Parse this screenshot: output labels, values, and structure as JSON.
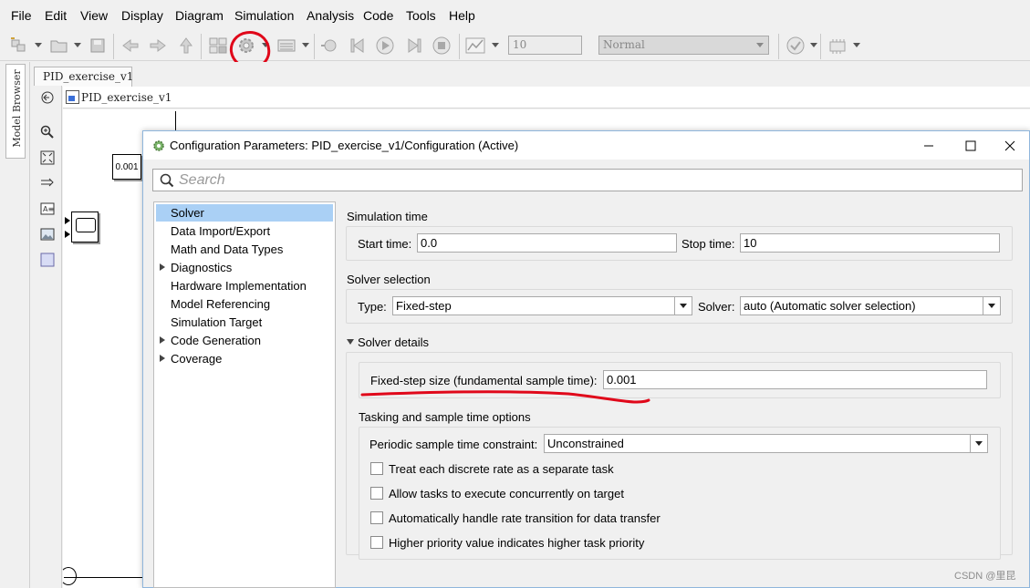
{
  "menubar": {
    "items": [
      "File",
      "Edit",
      "View",
      "Display",
      "Diagram",
      "Simulation",
      "Analysis",
      "Code",
      "Tools",
      "Help"
    ]
  },
  "toolbar": {
    "stop_time": "10",
    "sim_mode": "Normal",
    "icons": [
      "new-model-icon",
      "open-icon",
      "save-icon",
      "back-icon",
      "forward-icon",
      "up-icon",
      "library-browser-icon",
      "model-config-gear-icon",
      "model-explorer-icon",
      "step-back-icon",
      "run-icon",
      "step-forward-icon",
      "stop-icon",
      "data-inspector-icon",
      "model-advisor-icon",
      "build-icon"
    ],
    "highlight_color": "#e0081a"
  },
  "model_browser": {
    "label": "Model Browser"
  },
  "editor": {
    "tab_label": "PID_exercise_v1",
    "breadcrumb": "PID_exercise_v1",
    "constant_block_value": "0.001"
  },
  "dialog": {
    "title": "Configuration Parameters: PID_exercise_v1/Configuration (Active)",
    "search_placeholder": "Search",
    "tree": [
      {
        "label": "Solver",
        "expandable": false,
        "selected": true
      },
      {
        "label": "Data Import/Export",
        "expandable": false,
        "selected": false
      },
      {
        "label": "Math and Data Types",
        "expandable": false,
        "selected": false
      },
      {
        "label": "Diagnostics",
        "expandable": true,
        "selected": false
      },
      {
        "label": "Hardware Implementation",
        "expandable": false,
        "selected": false
      },
      {
        "label": "Model Referencing",
        "expandable": false,
        "selected": false
      },
      {
        "label": "Simulation Target",
        "expandable": false,
        "selected": false
      },
      {
        "label": "Code Generation",
        "expandable": true,
        "selected": false
      },
      {
        "label": "Coverage",
        "expandable": true,
        "selected": false
      }
    ],
    "simulation_time": {
      "heading": "Simulation time",
      "start_label": "Start time:",
      "start_value": "0.0",
      "stop_label": "Stop time:",
      "stop_value": "10"
    },
    "solver_selection": {
      "heading": "Solver selection",
      "type_label": "Type:",
      "type_value": "Fixed-step",
      "solver_label": "Solver:",
      "solver_value": "auto (Automatic solver selection)"
    },
    "solver_details": {
      "heading": "Solver details",
      "fixed_step_label": "Fixed-step size (fundamental sample time):",
      "fixed_step_value": "0.001"
    },
    "tasking": {
      "heading": "Tasking and sample time options",
      "constraint_label": "Periodic sample time constraint:",
      "constraint_value": "Unconstrained",
      "options": [
        {
          "label": "Treat each discrete rate as a separate task",
          "checked": false
        },
        {
          "label": "Allow tasks to execute concurrently on target",
          "checked": false
        },
        {
          "label": "Automatically handle rate transition for data transfer",
          "checked": false
        },
        {
          "label": "Higher priority value indicates higher task priority",
          "checked": false
        }
      ]
    }
  },
  "watermark": "CSDN @里昆"
}
